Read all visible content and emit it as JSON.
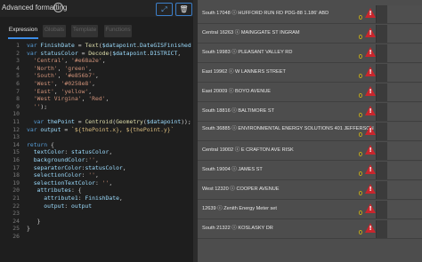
{
  "panel": {
    "title": "Advanced formatting",
    "info_icon": "info-icon",
    "expand_icon": "expand-icon",
    "delete_icon": "trash-icon"
  },
  "tabs": [
    {
      "label": "Expression",
      "active": true
    },
    {
      "label": "Globals"
    },
    {
      "label": "Template"
    },
    {
      "label": "Functions"
    }
  ],
  "code_lines": [
    {
      "n": "1",
      "text": "var FinishDate = Text($datapoint.DateGISFinished"
    },
    {
      "n": "2",
      "text": "var statusColor = Decode($datapoint.DISTRICT,"
    },
    {
      "n": "3",
      "text": "  'Central', '#e68a2e',"
    },
    {
      "n": "4",
      "text": "  'North', 'green',"
    },
    {
      "n": "5",
      "text": "  'South', '#e856b7',"
    },
    {
      "n": "6",
      "text": "  'West', '#0258e8',"
    },
    {
      "n": "7",
      "text": "  'East', 'yellow',"
    },
    {
      "n": "8",
      "text": "  'West Virgina', 'Red',"
    },
    {
      "n": "9",
      "text": "  '');"
    },
    {
      "n": "10",
      "text": ""
    },
    {
      "n": "11",
      "text": "  var thePoint = Centroid(Geometry($datapoint));"
    },
    {
      "n": "12",
      "text": "var output = `${thePoint.x}, ${thePoint.y}`"
    },
    {
      "n": "13",
      "text": ""
    },
    {
      "n": "14",
      "text": "return {"
    },
    {
      "n": "15",
      "text": "  textColor: statusColor,"
    },
    {
      "n": "16",
      "text": "  backgroundColor:'',"
    },
    {
      "n": "17",
      "text": "  separatorColor:statusColor,"
    },
    {
      "n": "18",
      "text": "  selectionColor: '',"
    },
    {
      "n": "19",
      "text": "  selectionTextColor: '',"
    },
    {
      "n": "20",
      "text": "   attributes: {"
    },
    {
      "n": "21",
      "text": "     attribute1: FinishDate,"
    },
    {
      "n": "22",
      "text": "     output: output"
    },
    {
      "n": "23",
      "text": ""
    },
    {
      "n": "24",
      "text": "   }"
    },
    {
      "n": "25",
      "text": "}"
    },
    {
      "n": "26",
      "text": ""
    }
  ],
  "list_rows": [
    {
      "text": "South 17048 ⓘ HUFFORD RUN RD PDG-88 1.186' ABD",
      "value": "0"
    },
    {
      "text": "Central 16263 ⓘ MAINGGATE ST INGRAM",
      "value": "0"
    },
    {
      "text": "South 19983 ⓘ PLEASANT VALLEY RD",
      "value": "0"
    },
    {
      "text": "East 19962 ⓘ W LANNERS STREET",
      "value": "0"
    },
    {
      "text": "East 20009 ⓘ BOYO AVENUE",
      "value": "0"
    },
    {
      "text": "South 18816 ⓘ BALTIMORE ST",
      "value": "0"
    },
    {
      "text": "South 36885 ⓘ ENVIRONMENTAL ENERGY SOLUTIONS 401 JEFFERSON",
      "value": "0"
    },
    {
      "text": "Central 19002 ⓘ E CRAFTON AVE RISK",
      "value": "0"
    },
    {
      "text": "South 19004 ⓘ JAMES ST",
      "value": "0"
    },
    {
      "text": "West 12320 ⓘ COOPER AVENUE",
      "value": "0"
    },
    {
      "text": "12639 ⓘ Zenith Energy Meter set",
      "value": "0"
    },
    {
      "text": "South 21322 ⓘ KOSLASKY DR",
      "value": "0"
    }
  ],
  "colors": {
    "code_default": "#d4d4d4",
    "code_keyword": "#569cd6",
    "code_string": "#ce9178",
    "code_function": "#dcdcaa",
    "code_variable": "#9cdcfe",
    "code_template": "#d7ba7d",
    "line_number": "#7c7c7c",
    "value_text": "#f5d200",
    "warning_fill": "#c9262d",
    "active_tab": "#3c8ce6"
  },
  "warning_icon": "warning-triangle-icon"
}
